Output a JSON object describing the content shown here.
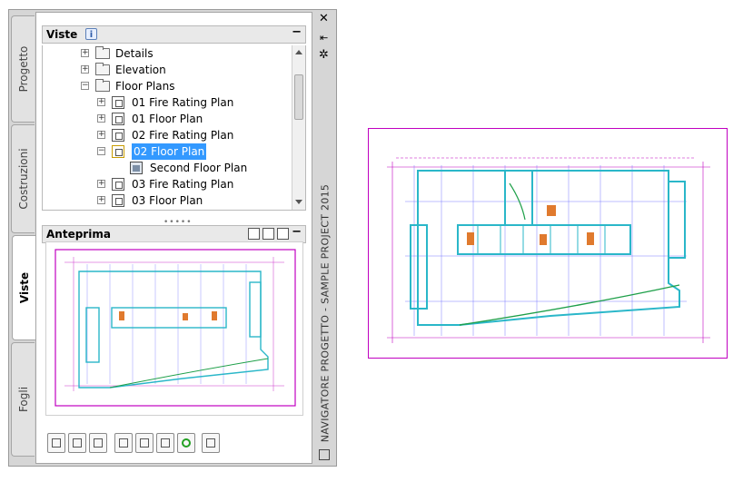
{
  "palette": {
    "tabs": [
      {
        "label": "Progetto",
        "active": false
      },
      {
        "label": "Costruzioni",
        "active": false
      },
      {
        "label": "Viste",
        "active": true
      },
      {
        "label": "Fogli",
        "active": false
      }
    ],
    "views_section": {
      "title": "Viste",
      "info_icon": "i",
      "collapse": "−"
    },
    "tree": [
      {
        "label": "Details",
        "icon": "folder-icon",
        "expander": "+"
      },
      {
        "label": "Elevation",
        "icon": "folder-icon",
        "expander": "+"
      },
      {
        "label": "Floor Plans",
        "icon": "folder-open-icon",
        "expander": "−"
      },
      {
        "label": "01 Fire Rating Plan",
        "icon": "view-icon",
        "expander": "+"
      },
      {
        "label": "01 Floor Plan",
        "icon": "view-icon",
        "expander": "+"
      },
      {
        "label": "02 Fire Rating Plan",
        "icon": "view-icon",
        "expander": "+"
      },
      {
        "label": "02 Floor Plan",
        "icon": "view-icon",
        "expander": "−",
        "selected": true
      },
      {
        "label": "Second Floor Plan",
        "icon": "sheet-icon",
        "expander": ""
      },
      {
        "label": "03 Fire Rating Plan",
        "icon": "view-icon",
        "expander": "+"
      },
      {
        "label": "03 Floor Plan",
        "icon": "view-icon",
        "expander": "+"
      }
    ],
    "preview_section": {
      "title": "Anteprima",
      "collapse": "−"
    },
    "side_title": "NAVIGATORE PROGETTO - SAMPLE PROJECT 2015",
    "window_controls": {
      "close": "✕",
      "pin": "⇤",
      "settings": "✲"
    }
  },
  "colors": {
    "selection": "#3399ff",
    "drawing_border": "#c000c0",
    "walls": "#2ab7c9",
    "grid": "#7a7aff"
  }
}
